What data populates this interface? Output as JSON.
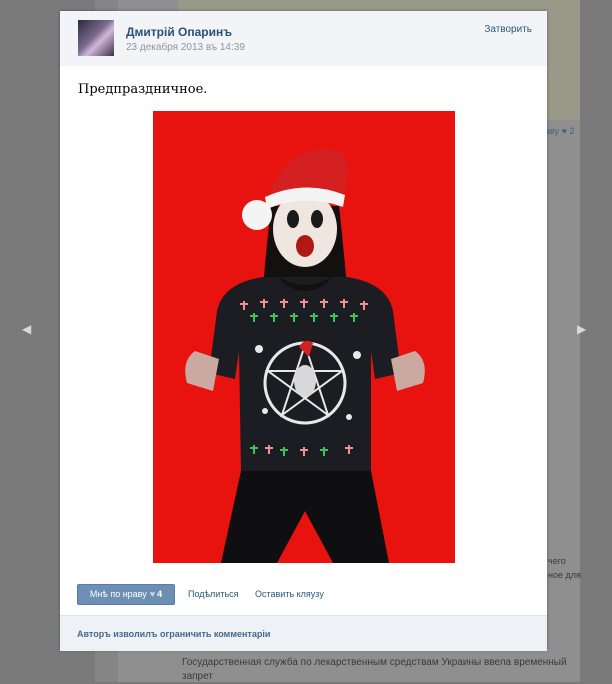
{
  "background": {
    "text_line1": "Государственная служба по лекарственным средствам Украины ввела временный запрет",
    "frag_like": "аву",
    "frag_like_count": "2",
    "frag_chego": "чего",
    "frag_dlya": "ное для",
    "arrow_left": "◀",
    "arrow_right": "▶"
  },
  "post": {
    "author": "Дмитрій Опаринъ",
    "date": "23 декабря 2013 въ 14:39",
    "close_label": "Затворить",
    "text": "Предпраздничное.",
    "like_label": "Мнѣ по нраву",
    "like_count": "4",
    "share_label": "Подѣлиться",
    "comment_label": "Оставить кляузу",
    "footer_note": "Авторъ изволилъ ограничить комментаріи"
  },
  "colors": {
    "photo_background": "#e8120f",
    "like_button": "#6d8fb3",
    "link": "#2b587a"
  },
  "icons": {
    "heart": "♥"
  }
}
